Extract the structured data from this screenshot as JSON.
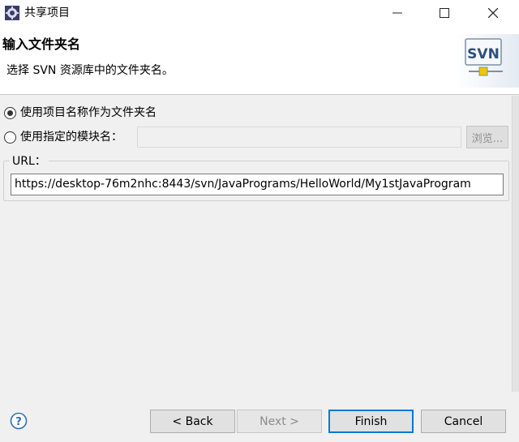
{
  "window": {
    "title": "共享项目",
    "icon": "eclipse-gear-icon",
    "controls": [
      "minimize",
      "maximize",
      "close"
    ]
  },
  "header": {
    "title": "输入文件夹名",
    "description": "选择 SVN 资源库中的文件夹名。",
    "logo_text": "SVN"
  },
  "options": {
    "use_project_name_label": "使用项目名称作为文件夹名",
    "use_project_name_selected": true,
    "use_module_name_label": "使用指定的模块名：",
    "use_module_name_selected": false,
    "module_name_value": "",
    "browse_label": "浏览..."
  },
  "url": {
    "label": "URL：",
    "value": "https://desktop-76m2nhc:8443/svn/JavaPrograms/HelloWorld/My1stJavaProgram"
  },
  "footer": {
    "back_label": "< Back",
    "next_label": "Next >",
    "finish_label": "Finish",
    "cancel_label": "Cancel"
  },
  "colors": {
    "accent": "#0078d7",
    "window_bg": "#f0f0f0",
    "header_bg": "#ffffff"
  }
}
